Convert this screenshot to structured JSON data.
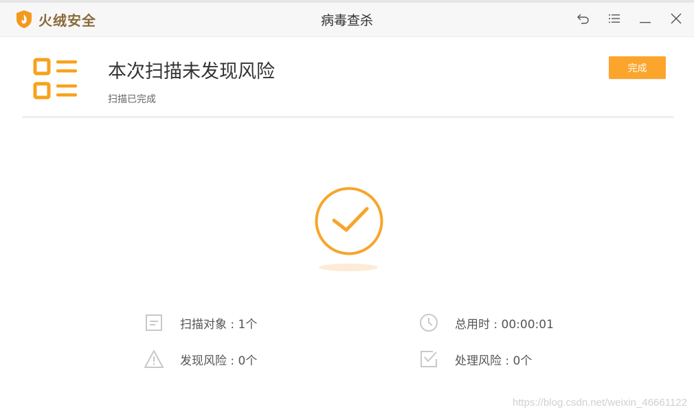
{
  "app": {
    "brand": "火绒安全",
    "window_title": "病毒查杀"
  },
  "titlebar_buttons": {
    "back": "back-icon",
    "menu": "menu-icon",
    "minimize": "minimize-icon",
    "close": "close-icon"
  },
  "result": {
    "headline": "本次扫描未发现风险",
    "subline": "扫描已完成",
    "done_label": "完成"
  },
  "stats": {
    "scan_objects": "扫描对象 : 1个",
    "total_time": "总用时 : 00:00:01",
    "risks_found": "发现风险 : 0个",
    "risks_handled": "处理风险 : 0个"
  },
  "watermark": "https://blog.csdn.net/weixin_46661122",
  "colors": {
    "accent": "#fba52d",
    "icon_gray": "#c8c8c8"
  }
}
